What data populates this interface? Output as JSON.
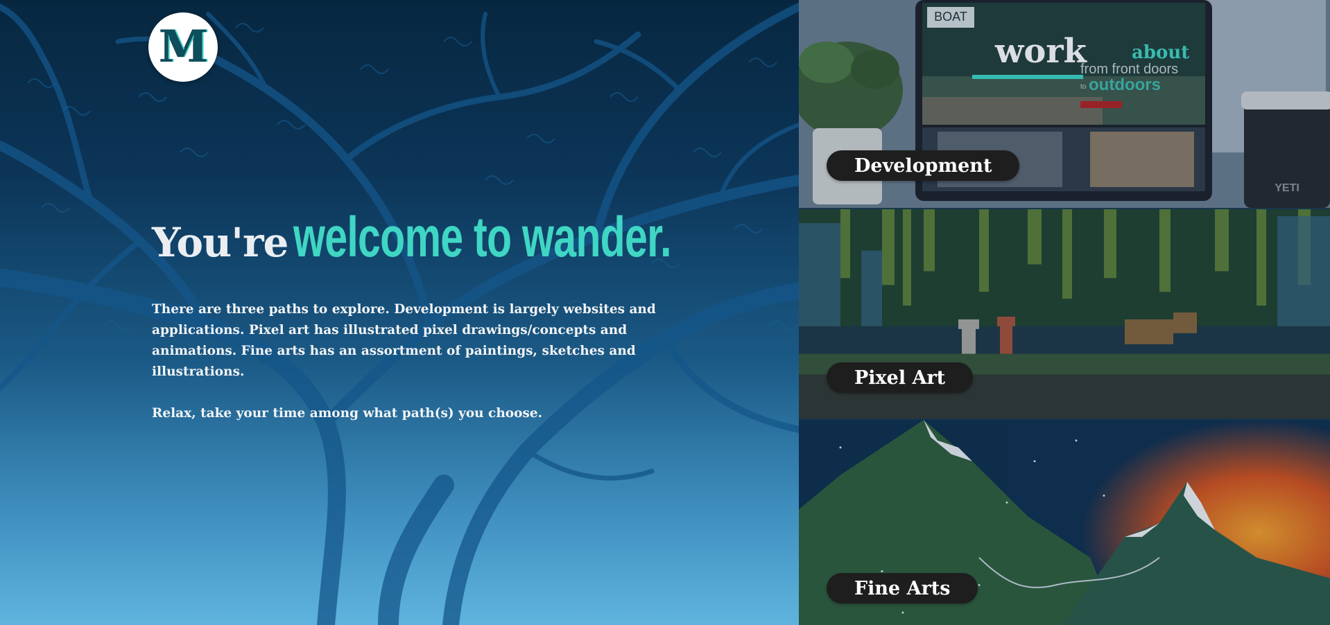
{
  "logo": {
    "letter": "M"
  },
  "hero": {
    "headline_plain": "You're",
    "headline_accent": "welcome to wander.",
    "paragraph_1": "There are three paths to explore. Development is largely websites and applications. Pixel art has illustrated pixel drawings/concepts and animations. Fine arts has an assortment of paintings, sketches and illustrations.",
    "paragraph_2": "Relax, take your time among what path(s) you choose."
  },
  "paths": [
    {
      "label": "Development",
      "screen": {
        "brand": "BOAT",
        "work": "work",
        "about": "about",
        "line_1": "from front doors",
        "line_2_prefix": "to",
        "line_2": "outdoors"
      },
      "cup_brand": "YETI"
    },
    {
      "label": "Pixel Art"
    },
    {
      "label": "Fine Arts"
    }
  ],
  "colors": {
    "accent": "#3fd6c4",
    "pill": "#1e1e1e",
    "hero_top": "#072740",
    "hero_bottom": "#5fb4de"
  }
}
